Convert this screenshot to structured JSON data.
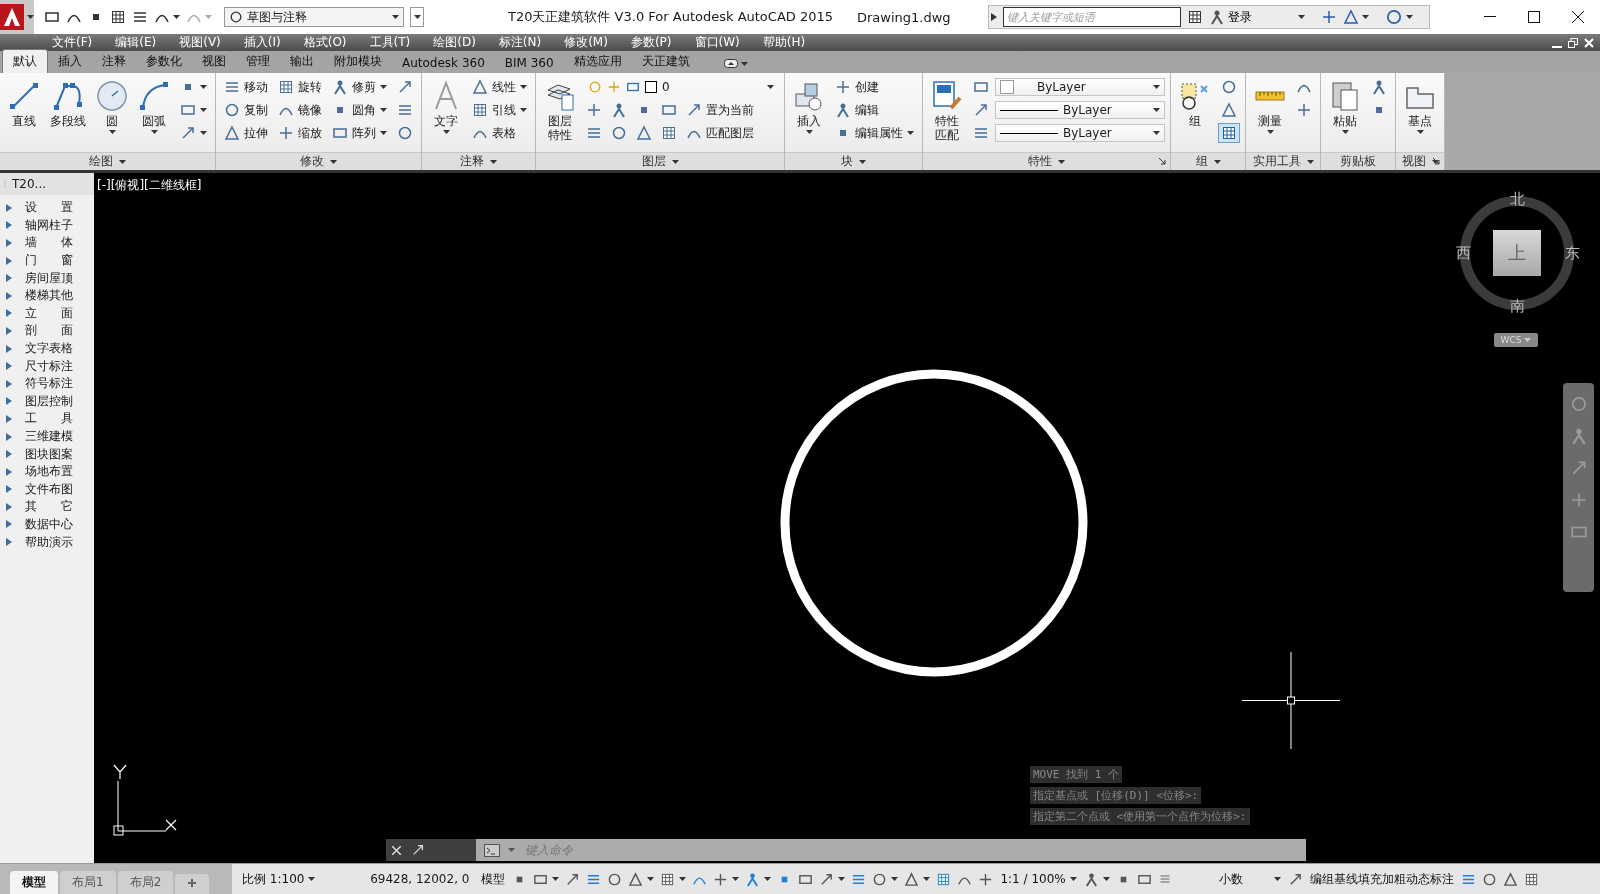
{
  "title_bar": {
    "workspace": "草图与注释",
    "title": "T20天正建筑软件 V3.0 For Autodesk AutoCAD 2015",
    "document": "Drawing1.dwg",
    "search": {
      "placeholder": "键入关键字或短语"
    },
    "sign_in": "登录"
  },
  "menu_bar": [
    "文件(F)",
    "编辑(E)",
    "视图(V)",
    "插入(I)",
    "格式(O)",
    "工具(T)",
    "绘图(D)",
    "标注(N)",
    "修改(M)",
    "参数(P)",
    "窗口(W)",
    "帮助(H)"
  ],
  "ribbon": {
    "tabs": [
      {
        "label": "默认",
        "selected": true
      },
      {
        "label": "插入",
        "selected": false
      },
      {
        "label": "注释",
        "selected": false
      },
      {
        "label": "参数化",
        "selected": false
      },
      {
        "label": "视图",
        "selected": false
      },
      {
        "label": "管理",
        "selected": false
      },
      {
        "label": "输出",
        "selected": false
      },
      {
        "label": "附加模块",
        "selected": false
      },
      {
        "label": "Autodesk 360",
        "selected": false
      },
      {
        "label": "BIM 360",
        "selected": false
      },
      {
        "label": "精选应用",
        "selected": false
      },
      {
        "label": "天正建筑",
        "selected": false
      }
    ],
    "panels": [
      {
        "title": "绘图",
        "dropdown": true,
        "columns": [
          {
            "kind": "large",
            "label": "直线"
          },
          {
            "kind": "large",
            "label": "多段线"
          },
          {
            "kind": "large",
            "label": "圆",
            "dropdown": true
          },
          {
            "kind": "large",
            "label": "圆弧",
            "dropdown": true
          },
          {
            "kind": "stack",
            "rows": [
              [
                {
                  "kind": "icon",
                  "dropdown": true
                }
              ],
              [
                {
                  "kind": "icon",
                  "dropdown": true
                }
              ],
              [
                {
                  "kind": "icon",
                  "dropdown": true
                }
              ]
            ]
          }
        ]
      },
      {
        "title": "修改",
        "dropdown": true,
        "columns": [
          {
            "kind": "stack",
            "rows": [
              [
                {
                  "kind": "tool",
                  "label": "移动"
                }
              ],
              [
                {
                  "kind": "tool",
                  "label": "复制"
                }
              ],
              [
                {
                  "kind": "tool",
                  "label": "拉伸"
                }
              ]
            ]
          },
          {
            "kind": "stack",
            "rows": [
              [
                {
                  "kind": "tool",
                  "label": "旋转"
                }
              ],
              [
                {
                  "kind": "tool",
                  "label": "镜像"
                }
              ],
              [
                {
                  "kind": "tool",
                  "label": "缩放"
                }
              ]
            ]
          },
          {
            "kind": "stack",
            "rows": [
              [
                {
                  "kind": "tool",
                  "label": "修剪",
                  "dropdown": true
                }
              ],
              [
                {
                  "kind": "tool",
                  "label": "圆角",
                  "dropdown": true
                }
              ],
              [
                {
                  "kind": "tool",
                  "label": "阵列",
                  "dropdown": true
                }
              ]
            ]
          },
          {
            "kind": "stack",
            "rows": [
              [
                {
                  "kind": "icon"
                }
              ],
              [
                {
                  "kind": "icon"
                }
              ],
              [
                {
                  "kind": "icon"
                }
              ]
            ]
          }
        ]
      },
      {
        "title": "注释",
        "dropdown": true,
        "columns": [
          {
            "kind": "large",
            "label": "文字",
            "dropdown": true
          },
          {
            "kind": "stack",
            "rows": [
              [
                {
                  "kind": "tool",
                  "label": "线性",
                  "dropdown": true
                }
              ],
              [
                {
                  "kind": "tool",
                  "label": "引线",
                  "dropdown": true
                }
              ],
              [
                {
                  "kind": "tool",
                  "label": "表格"
                }
              ]
            ]
          }
        ]
      },
      {
        "title": "图层",
        "dropdown": true,
        "columns": [
          {
            "kind": "large_wrapped",
            "label": "图层特性"
          },
          {
            "kind": "stack",
            "rows": [
              [
                {
                  "kind": "layer_combo",
                  "value": "0"
                }
              ],
              [
                {
                  "kind": "icon"
                },
                {
                  "kind": "icon"
                },
                {
                  "kind": "icon"
                },
                {
                  "kind": "icon"
                },
                {
                  "kind": "tool",
                  "label": "置为当前"
                }
              ],
              [
                {
                  "kind": "icon"
                },
                {
                  "kind": "icon"
                },
                {
                  "kind": "icon"
                },
                {
                  "kind": "icon"
                },
                {
                  "kind": "tool",
                  "label": "匹配图层"
                }
              ]
            ]
          }
        ]
      },
      {
        "title": "块",
        "dropdown": true,
        "columns": [
          {
            "kind": "large",
            "label": "插入",
            "dropdown": true
          },
          {
            "kind": "stack",
            "rows": [
              [
                {
                  "kind": "tool",
                  "label": "创建"
                }
              ],
              [
                {
                  "kind": "tool",
                  "label": "编辑"
                }
              ],
              [
                {
                  "kind": "tool",
                  "label": "编辑属性",
                  "dropdown": true
                }
              ]
            ]
          }
        ]
      },
      {
        "title": "特性",
        "dropdown": true,
        "launcher": true,
        "columns": [
          {
            "kind": "large_wrapped",
            "label": "特性匹配"
          },
          {
            "kind": "stack",
            "rows": [
              [
                {
                  "kind": "icon"
                },
                {
                  "kind": "color_combo",
                  "value": "ByLayer"
                }
              ],
              [
                {
                  "kind": "icon"
                },
                {
                  "kind": "line_combo",
                  "value": "ByLayer"
                }
              ],
              [
                {
                  "kind": "icon"
                },
                {
                  "kind": "line_combo",
                  "value": "ByLayer"
                }
              ]
            ]
          }
        ]
      },
      {
        "title": "组",
        "dropdown": true,
        "columns": [
          {
            "kind": "large",
            "label": "组"
          },
          {
            "kind": "stack",
            "rows": [
              [
                {
                  "kind": "icon",
                  "on": false
                }
              ],
              [
                {
                  "kind": "icon",
                  "on": false
                }
              ],
              [
                {
                  "kind": "icon",
                  "on": true
                }
              ]
            ]
          }
        ]
      },
      {
        "title": "实用工具",
        "dropdown": true,
        "columns": [
          {
            "kind": "large",
            "label": "测量",
            "dropdown": true
          },
          {
            "kind": "stack",
            "rows": [
              [
                {
                  "kind": "icon"
                }
              ],
              [
                {
                  "kind": "icon"
                }
              ]
            ]
          }
        ]
      },
      {
        "title": "剪贴板",
        "columns": [
          {
            "kind": "large",
            "label": "粘贴",
            "dropdown": true
          },
          {
            "kind": "stack",
            "rows": [
              [
                {
                  "kind": "icon"
                }
              ],
              [
                {
                  "kind": "icon"
                }
              ]
            ]
          }
        ]
      },
      {
        "title": "视图",
        "dropdown": true,
        "launcher": true,
        "columns": [
          {
            "kind": "large",
            "label": "基点",
            "dropdown": true
          }
        ]
      }
    ]
  },
  "palette": {
    "title": "T20...",
    "items": [
      {
        "label": "设 置",
        "expanded": false
      },
      {
        "label": "轴网柱子",
        "expanded": false
      },
      {
        "label": "墙 体",
        "expanded": false
      },
      {
        "label": "门 窗",
        "expanded": false
      },
      {
        "label": "房间屋顶",
        "expanded": false
      },
      {
        "label": "楼梯其他",
        "expanded": false
      },
      {
        "label": "立 面",
        "expanded": false
      },
      {
        "label": "剖 面",
        "expanded": false
      },
      {
        "label": "文字表格",
        "expanded": false
      },
      {
        "label": "尺寸标注",
        "expanded": false
      },
      {
        "label": "符号标注",
        "expanded": false
      },
      {
        "label": "图层控制",
        "expanded": false
      },
      {
        "label": "工 具",
        "expanded": false
      },
      {
        "label": "三维建模",
        "expanded": false
      },
      {
        "label": "图块图案",
        "expanded": false
      },
      {
        "label": "场地布置",
        "expanded": false
      },
      {
        "label": "文件布图",
        "expanded": false
      },
      {
        "label": "其 它",
        "expanded": false
      },
      {
        "label": "数据中心",
        "expanded": false
      },
      {
        "label": "帮助演示",
        "expanded": false
      }
    ]
  },
  "viewport": {
    "label": "[-][俯视][二维线框]",
    "compass": {
      "north": "北",
      "south": "南",
      "east": "东",
      "west": "西",
      "top": "上",
      "wcs": "WCS"
    },
    "history": [
      "MOVE 找到 1 个",
      "指定基点或 [位移(D)] <位移>:",
      "指定第二个点或 <使用第一个点作为位移>:"
    ],
    "command": {
      "placeholder": "键入命令"
    }
  },
  "layout_tabs": [
    {
      "label": "模型",
      "selected": true
    },
    {
      "label": "布局1",
      "selected": false
    },
    {
      "label": "布局2",
      "selected": false
    }
  ],
  "status_bar": {
    "items": [
      {
        "kind": "text",
        "label": "比例 1:100",
        "dropdown": true
      },
      {
        "kind": "coords",
        "label": "69428, 12002, 0"
      },
      {
        "kind": "text",
        "label": "模型"
      },
      {
        "kind": "icon",
        "on": false
      },
      {
        "kind": "icon",
        "on": false,
        "dropdown": true
      },
      {
        "kind": "icon",
        "on": false
      },
      {
        "kind": "icon",
        "on": true
      },
      {
        "kind": "icon",
        "on": false
      },
      {
        "kind": "icon",
        "on": false,
        "dropdown": true
      },
      {
        "kind": "icon",
        "on": false,
        "dropdown": true
      },
      {
        "kind": "icon",
        "on": true
      },
      {
        "kind": "icon",
        "on": false,
        "dropdown": true
      },
      {
        "kind": "icon",
        "on": true,
        "dropdown": true
      },
      {
        "kind": "icon",
        "on": true
      },
      {
        "kind": "icon",
        "on": false
      },
      {
        "kind": "icon",
        "on": false,
        "dropdown": true
      },
      {
        "kind": "icon",
        "on": true
      },
      {
        "kind": "icon",
        "on": false,
        "dropdown": true
      },
      {
        "kind": "icon",
        "on": false,
        "dropdown": true
      },
      {
        "kind": "icon",
        "on": true
      },
      {
        "kind": "icon",
        "on": false
      },
      {
        "kind": "icon",
        "on": false
      },
      {
        "kind": "text",
        "label": "1:1 / 100%",
        "dropdown": true
      },
      {
        "kind": "icon",
        "on": false,
        "dropdown": true
      },
      {
        "kind": "icon",
        "on": false
      },
      {
        "kind": "icon",
        "on": false
      },
      {
        "kind": "combo",
        "label": "小数"
      },
      {
        "kind": "icon",
        "on": false
      },
      {
        "kind": "text",
        "label": "编组基线填充加粗动态标注"
      },
      {
        "kind": "icon",
        "on": true
      },
      {
        "kind": "icon",
        "on": false
      },
      {
        "kind": "icon",
        "on": false
      },
      {
        "kind": "icon",
        "on": false
      }
    ]
  }
}
